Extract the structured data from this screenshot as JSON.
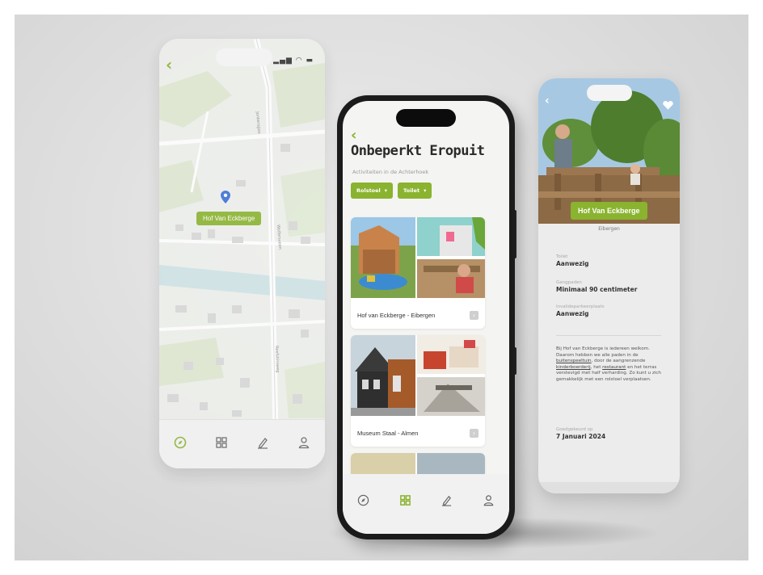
{
  "colors": {
    "accent": "#8ab32f",
    "background": "#dcdcdc",
    "phone_frame": "#1b1b1b"
  },
  "map_screen": {
    "back_icon": "chevron-left-icon",
    "status_icons": "signal-wifi-battery",
    "location_label": "Hof Van Eckberge",
    "road_labels": [
      "Jonkersgoo",
      "Wolfersveen",
      "Reefstinsweg"
    ],
    "nav": [
      {
        "icon": "compass-icon",
        "active": true
      },
      {
        "icon": "grid-icon",
        "active": false
      },
      {
        "icon": "pencil-icon",
        "active": false
      },
      {
        "icon": "user-icon",
        "active": false
      }
    ]
  },
  "list_screen": {
    "back_icon": "chevron-left-icon",
    "title": "Onbeperkt Eropuit",
    "subtitle": "Activiteiten in de Achterhoek",
    "filters": [
      {
        "label": "Rolstoel",
        "icon": "chevron-down-icon"
      },
      {
        "label": "Toilet",
        "icon": "chevron-down-icon"
      }
    ],
    "cards": [
      {
        "title": "Hof van Eckberge - Eibergen",
        "icon": "chevron-right-icon"
      },
      {
        "title": "Museum Staal - Almen",
        "icon": "chevron-right-icon"
      }
    ],
    "nav": [
      {
        "icon": "compass-icon",
        "active": false
      },
      {
        "icon": "grid-icon",
        "active": true
      },
      {
        "icon": "pencil-icon",
        "active": false
      },
      {
        "icon": "user-icon",
        "active": false
      }
    ]
  },
  "detail_screen": {
    "back_icon": "chevron-left-icon",
    "favorite_icon": "heart-icon",
    "name": "Hof Van Eckberge",
    "location": "Eibergen",
    "fields": [
      {
        "label": "Toilet",
        "value": "Aanwezig"
      },
      {
        "label": "Gangpaden",
        "value": "Minimaal 90 centimeter"
      },
      {
        "label": "Invalideparkeerplaats",
        "value": "Aanwezig"
      }
    ],
    "description": {
      "p1": "Bij Hof van Eckberge is iedereen welkom. Daarom hebben we alle paden in de ",
      "link1": "buitenspeeltuin",
      "p2": ", door de aangrenzende ",
      "link2": "kinderboerderij",
      "p3": ", het ",
      "link3": "restaurant",
      "p4": " en het terras verstevigd met half verharding. Zo kunt u zich gemakkelijk met een rolstoel verplaatsen."
    },
    "approved": {
      "label": "Goedgekeurd op",
      "value": "7 Januari 2024"
    }
  }
}
